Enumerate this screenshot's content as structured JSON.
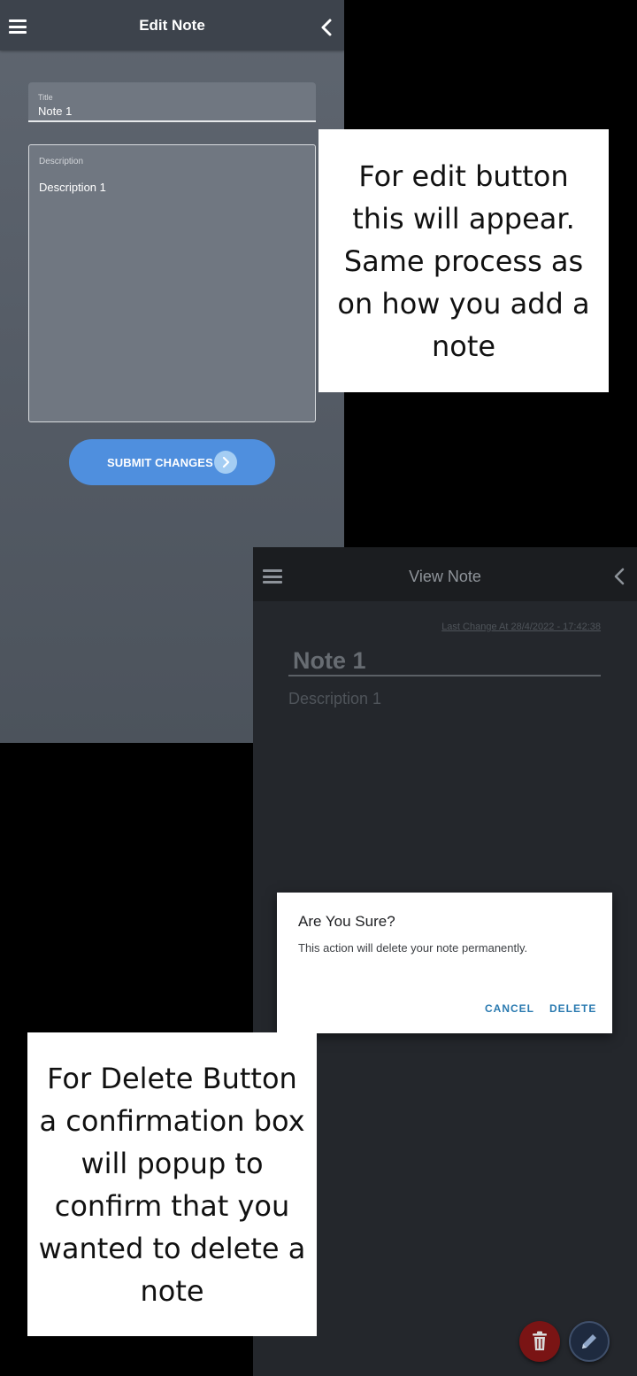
{
  "edit_screen": {
    "appbar": {
      "title": "Edit Note",
      "menu_icon": "hamburger-menu-icon",
      "back_icon": "chevron-left-icon"
    },
    "title_field": {
      "label": "Title",
      "value": "Note 1"
    },
    "description_field": {
      "label": "Description",
      "value": "Description 1"
    },
    "submit_button": {
      "label": "SUBMIT CHANGES",
      "icon": "chevron-right-icon"
    }
  },
  "callouts": {
    "edit": "For edit button this will appear. Same process as on how you add a note",
    "delete": "For Delete Button a confirmation box will popup to confirm that you wanted to delete a note"
  },
  "view_screen": {
    "appbar": {
      "title": "View Note",
      "menu_icon": "hamburger-menu-icon",
      "back_icon": "chevron-left-icon"
    },
    "last_change": "Last Change At 28/4/2022 - 17:42:38",
    "note_title": "Note 1",
    "note_description": "Description 1",
    "fab_delete_icon": "trash-icon",
    "fab_edit_icon": "pencil-icon"
  },
  "dialog": {
    "title": "Are You Sure?",
    "message": "This action will delete your note permanently.",
    "cancel_label": "CANCEL",
    "delete_label": "DELETE"
  },
  "colors": {
    "submit_button": "#4f8fde",
    "dialog_action": "#2a7ab0",
    "delete_fab": "#7a1414",
    "edit_fab": "#1e2a3f"
  }
}
